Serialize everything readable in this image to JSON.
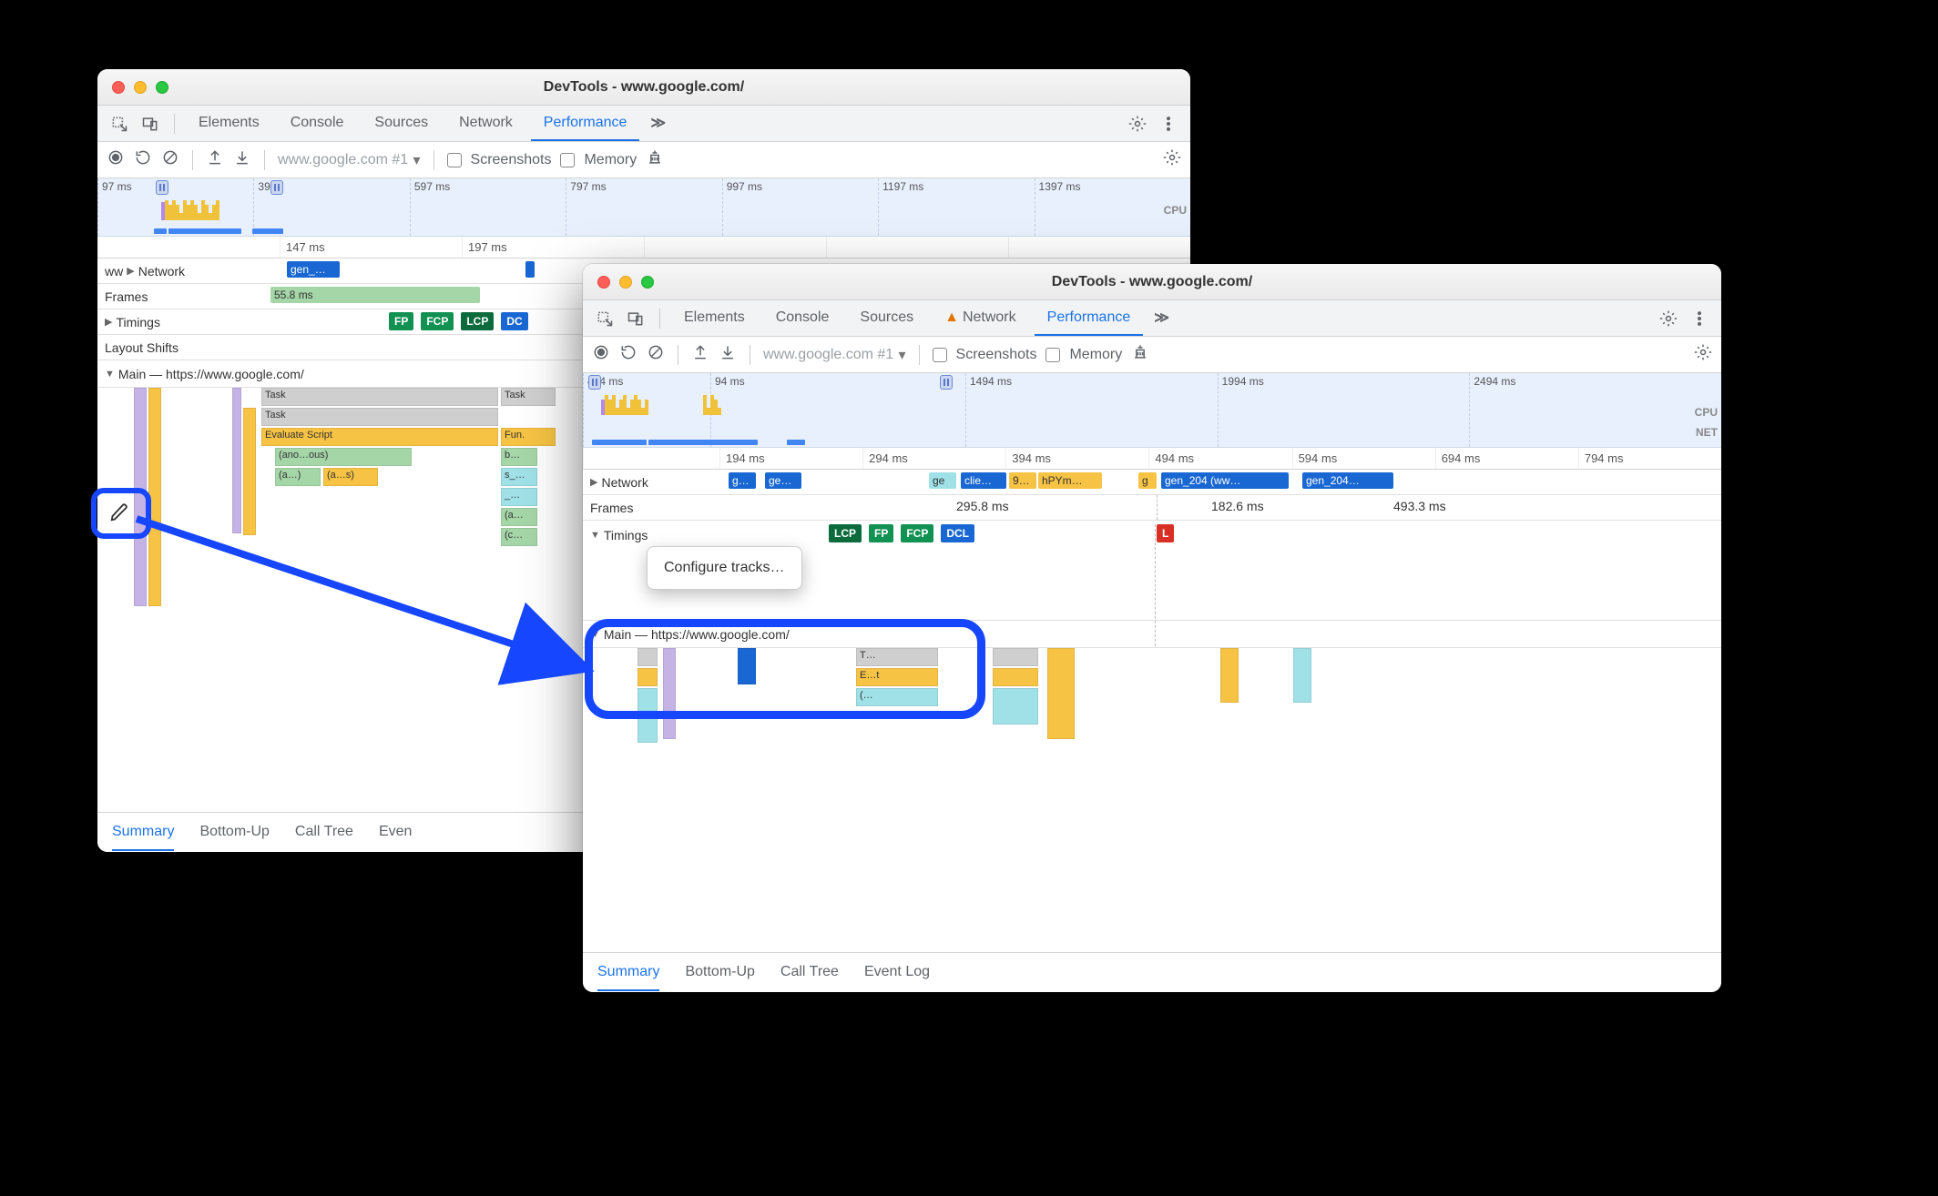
{
  "annotation": {
    "context_menu_item": "Configure tracks…"
  },
  "window1": {
    "title": "DevTools - www.google.com/",
    "top_tabs": [
      "Elements",
      "Console",
      "Sources",
      "Network",
      "Performance"
    ],
    "top_active": "Performance",
    "overflow_glyph": "≫",
    "toolbar": {
      "dropdown": "www.google.com #1",
      "cb_screenshots": "Screenshots",
      "cb_memory": "Memory"
    },
    "overview_ticks": [
      "97 ms",
      "397",
      "597 ms",
      "797 ms",
      "997 ms",
      "1197 ms",
      "1397 ms"
    ],
    "cpu_label": "CPU",
    "ruler_ticks": [
      "147 ms",
      "197 ms"
    ],
    "tracks": {
      "ww_label": "ww",
      "network": "Network",
      "network_chip": "gen_…",
      "frames": "Frames",
      "frames_val": "55.8 ms",
      "timings": "Timings",
      "timing_badges": [
        "FP",
        "FCP",
        "LCP",
        "DC"
      ],
      "layoutshifts": "Layout Shifts",
      "main": "Main — https://www.google.com/",
      "flame_rows": {
        "r0a": "Task",
        "r0b": "Task",
        "r1a": "Task",
        "r2a": "Evaluate Script",
        "r2b": "Fun.",
        "r3a": "(ano…ous)",
        "r3b": "b…",
        "r4a": "(a…)",
        "r4b": "(a…s)",
        "r4c": "s_…",
        "r5a": "_…",
        "r6a": "(a…",
        "r7a": "(c…"
      }
    },
    "bottom_tabs": [
      "Summary",
      "Bottom-Up",
      "Call Tree",
      "Even"
    ],
    "bottom_active": "Summary"
  },
  "window2": {
    "title": "DevTools - www.google.com/",
    "top_tabs": [
      "Elements",
      "Console",
      "Sources",
      "Network",
      "Performance"
    ],
    "top_active": "Performance",
    "network_has_warning": true,
    "overflow_glyph": "≫",
    "toolbar": {
      "dropdown": "www.google.com #1",
      "cb_screenshots": "Screenshots",
      "cb_memory": "Memory"
    },
    "overview_ticks": [
      "494 ms",
      "94 ms",
      "1494 ms",
      "1994 ms",
      "2494 ms"
    ],
    "cpu_label": "CPU",
    "net_label": "NET",
    "ruler_ticks": [
      "194 ms",
      "294 ms",
      "394 ms",
      "494 ms",
      "594 ms",
      "694 ms",
      "794 ms"
    ],
    "tracks": {
      "network": "Network",
      "network_chips": [
        "g…",
        "ge…",
        "ge",
        "clie…",
        "9…",
        "hPYm…",
        "g",
        "gen_204 (ww…",
        "gen_204…"
      ],
      "frames": "Frames",
      "frames_vals": [
        "295.8 ms",
        "182.6 ms",
        "493.3 ms"
      ],
      "timings": "Timings",
      "timing_badges": [
        "LCP",
        "FP",
        "FCP",
        "DCL"
      ],
      "timing_L": "L",
      "main": "Main — https://www.google.com/",
      "flame_rows": {
        "r0": "T…",
        "r1": "E…t",
        "r2": "(…"
      }
    },
    "bottom_tabs": [
      "Summary",
      "Bottom-Up",
      "Call Tree",
      "Event Log"
    ],
    "bottom_active": "Summary"
  }
}
